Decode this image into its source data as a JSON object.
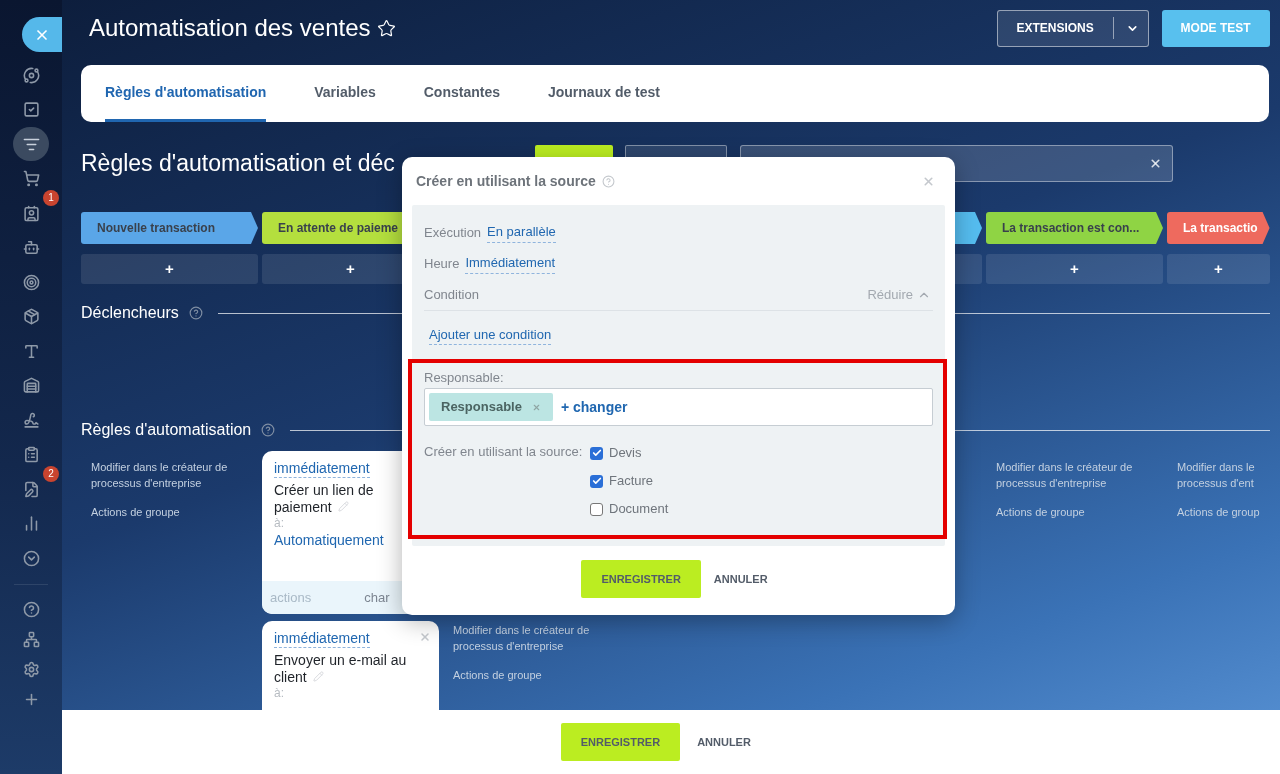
{
  "sidebar": {
    "items": [
      {
        "selected": false
      },
      {
        "selected": false
      },
      {
        "selected": true
      },
      {
        "selected": false
      },
      {
        "selected": false,
        "badge": "1"
      },
      {
        "selected": false
      },
      {
        "selected": false
      },
      {
        "selected": false
      },
      {
        "selected": false
      },
      {
        "selected": false
      },
      {
        "selected": false
      },
      {
        "selected": false
      },
      {
        "selected": false,
        "badge": "2"
      },
      {
        "selected": false
      },
      {
        "selected": false
      }
    ],
    "bottom_items": [
      {
        "selected": false
      },
      {
        "selected": false
      },
      {
        "selected": false
      },
      {
        "selected": false
      }
    ]
  },
  "header": {
    "title": "Automatisation des ventes",
    "favorite": false,
    "extensions_button": "EXTENSIONS",
    "test_button": "MODE TEST"
  },
  "tabs": [
    {
      "label": "Règles d'automatisation",
      "selected": true
    },
    {
      "label": "Variables",
      "selected": false
    },
    {
      "label": "Constantes",
      "selected": false
    },
    {
      "label": "Journaux de test",
      "selected": false
    }
  ],
  "section_title": "Règles d'automatisation et déc",
  "triggers_title": "Déclencheurs",
  "rules_title": "Règles d'automatisation",
  "columns_left": [
    {
      "stage": {
        "label": "Nouvelle transaction",
        "color": "#5aa6e8"
      },
      "add": "+",
      "links": [
        "Modifier dans le créateur de processus d'entreprise",
        "Actions de groupe"
      ]
    },
    {
      "stage": {
        "label": "En attente de paieme",
        "color": "#b4df3e"
      },
      "add": "+",
      "cards": [
        {
          "kind": "rule",
          "delay": "immédiatement",
          "title": "Créer un lien de paiement",
          "to_label": "à:",
          "to": "Automatiquement",
          "footer_left": "actions",
          "footer_right": "char"
        },
        {
          "kind": "rule",
          "delay": "immédiatement",
          "title": "Envoyer un e-mail au client",
          "to_label": "à:",
          "closable": true
        }
      ]
    },
    {
      "cards": [
        {
          "kind": "covered"
        }
      ],
      "links": [
        "Modifier dans le créateur de processus d'entreprise",
        "Actions de groupe"
      ]
    }
  ],
  "columns_right": [
    {
      "stage": {
        "color": "#55bdf0"
      }
    },
    {
      "stage": {
        "label": "La transaction est con...",
        "color": "#8fd444"
      },
      "add": "+",
      "links": [
        "Modifier dans le créateur de processus d'entreprise",
        "Actions de groupe"
      ]
    },
    {
      "stage": {
        "label": "La transactio",
        "color": "#ee6a5e"
      },
      "add": "+",
      "links": [
        "Modifier dans le processus d'ent",
        "Actions de group"
      ]
    }
  ],
  "dialog": {
    "title": "Créer en utilisant la source",
    "settings": [
      {
        "label": "Exécution",
        "value": "En parallèle"
      },
      {
        "label": "Heure",
        "value": "Immédiatement"
      }
    ],
    "condition": {
      "label": "Condition",
      "toggle": "Réduire",
      "expanded": true,
      "add_link": "Ajouter une condition"
    },
    "responsible": {
      "label": "Responsable:",
      "tags": [
        "Responsable"
      ],
      "change_link": "+ changer"
    },
    "sources": {
      "label": "Créer en utilisant la source:",
      "options": [
        {
          "label": "Devis",
          "checked": true
        },
        {
          "label": "Facture",
          "checked": true
        },
        {
          "label": "Document",
          "checked": false
        }
      ]
    },
    "buttons": {
      "save": "ENREGISTRER",
      "cancel": "ANNULER"
    }
  },
  "footer": {
    "save": "ENREGISTRER",
    "cancel": "ANNULER"
  }
}
